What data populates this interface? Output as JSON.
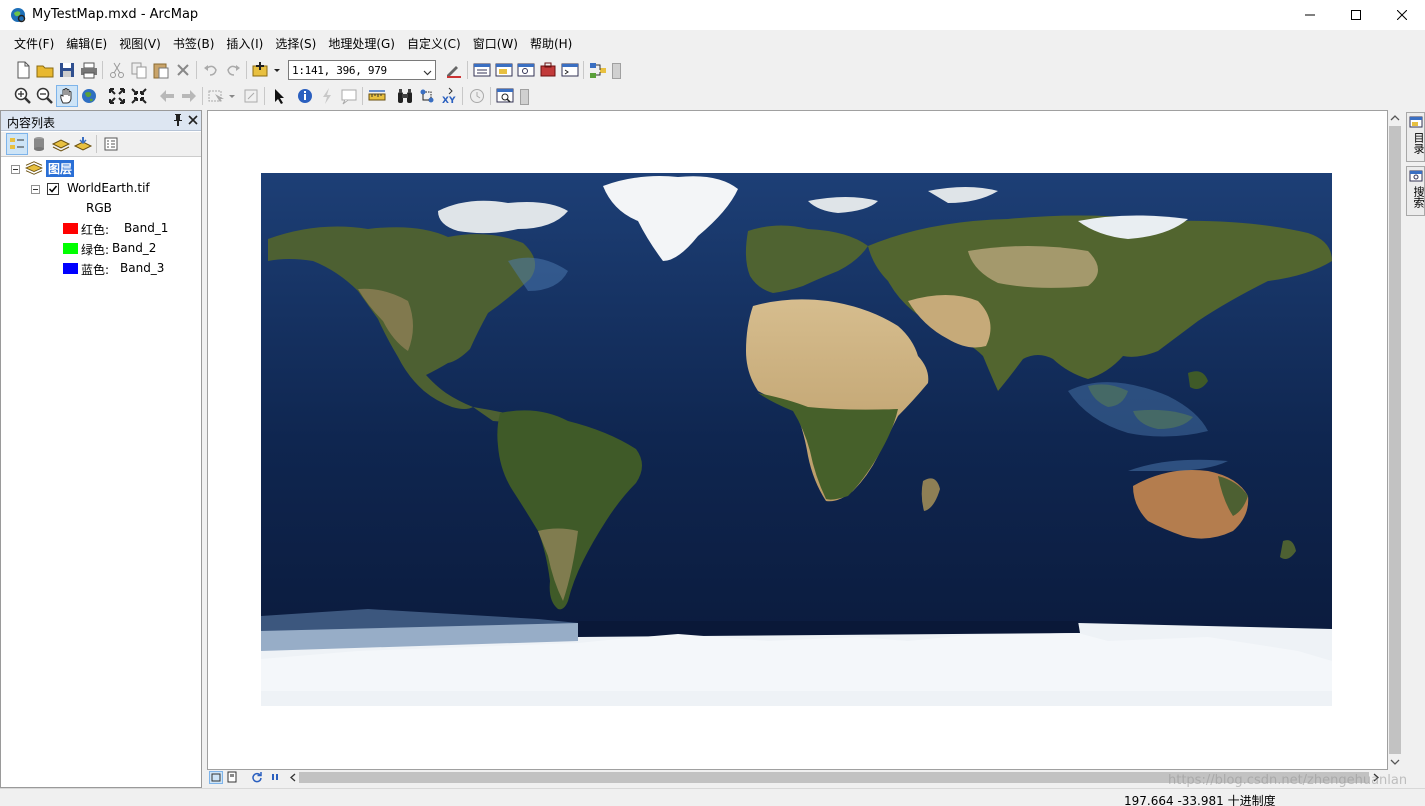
{
  "window": {
    "title": "MyTestMap.mxd - ArcMap",
    "icon": "arcmap-globe-icon"
  },
  "menu": [
    "文件(F)",
    "编辑(E)",
    "视图(V)",
    "书签(B)",
    "插入(I)",
    "选择(S)",
    "地理处理(G)",
    "自定义(C)",
    "窗口(W)",
    "帮助(H)"
  ],
  "toolbar": {
    "scale": "1:141, 396, 979"
  },
  "toc": {
    "title": "内容列表",
    "root_label": "图层",
    "layer": {
      "name": "WorldEarth.tif",
      "checked": true,
      "render": "RGB",
      "bands": [
        {
          "label": "红色:",
          "value": "Band_1",
          "color": "#ff0000"
        },
        {
          "label": "绿色:",
          "value": "Band_2",
          "color": "#00ff00"
        },
        {
          "label": "蓝色:",
          "value": "Band_3",
          "color": "#0000ff"
        }
      ]
    }
  },
  "side_tabs": [
    "目录",
    "搜索"
  ],
  "status": {
    "coordinates": "197.664  -33.981 十进制度",
    "watermark": "https://blog.csdn.net/zhengehuanlan"
  },
  "colors": {
    "ocean_deep": "#0a1838",
    "ocean": "#1d3f76",
    "shelf": "#4d7cb2",
    "land": "#4a5e2e",
    "desert": "#c9ad7c",
    "ice": "#f2f5f8"
  }
}
